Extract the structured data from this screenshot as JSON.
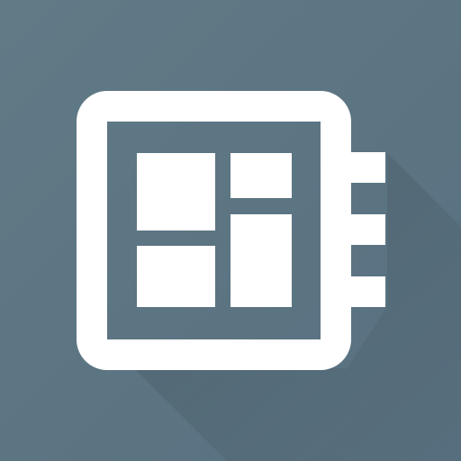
{
  "icon": {
    "name": "notebook-dashboard-icon",
    "colors": {
      "background": "#5b7480",
      "background_light": "#617a86",
      "shadow": "#4f6570",
      "glyph": "#ffffff"
    }
  }
}
